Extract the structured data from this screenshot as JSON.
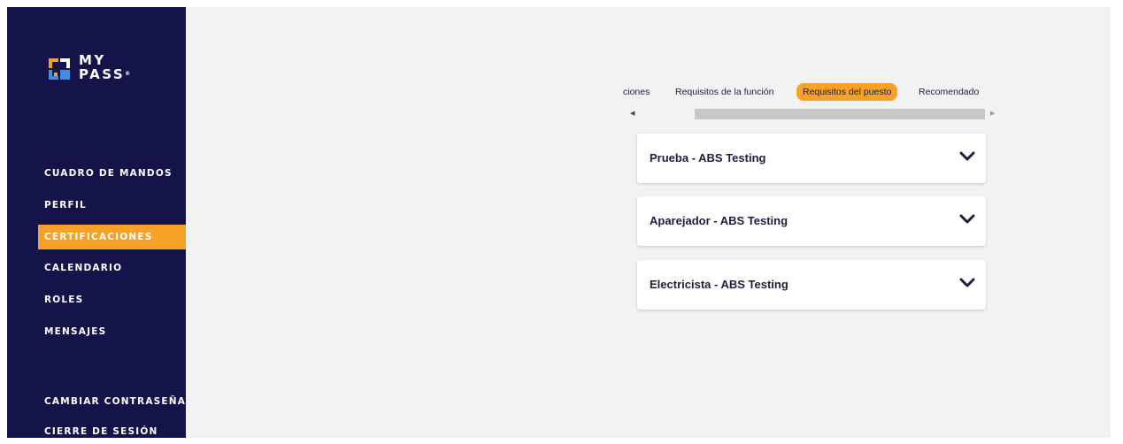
{
  "brand": {
    "line1": "MY",
    "line2": "PASS",
    "tm": "®"
  },
  "sidebar": {
    "items": [
      {
        "label": "CUADRO DE MANDOS",
        "active": false
      },
      {
        "label": "PERFIL",
        "active": false
      },
      {
        "label": "CERTIFICACIONES",
        "active": true
      },
      {
        "label": "CALENDARIO",
        "active": false
      },
      {
        "label": "ROLES",
        "active": false
      },
      {
        "label": "MENSAJES",
        "active": false
      },
      {
        "label": "CAMBIAR CONTRASEÑA",
        "active": false
      },
      {
        "label": "CIERRE DE SESIÓN",
        "active": false
      }
    ]
  },
  "tabs": [
    {
      "label": "ciones",
      "active": false
    },
    {
      "label": "Requisitos de la función",
      "active": false
    },
    {
      "label": "Requisitos del puesto",
      "active": true
    },
    {
      "label": "Recomendado",
      "active": false
    }
  ],
  "scroll": {
    "left_arrow": "◀",
    "right_arrow": "▶"
  },
  "cards": [
    {
      "title": "Prueba - ABS Testing"
    },
    {
      "title": "Aparejador - ABS Testing"
    },
    {
      "title": "Electricista - ABS Testing"
    }
  ],
  "colors": {
    "sidebar": "#14144a",
    "accent": "#f7a128",
    "text": "#1d1d3f",
    "logo_orange": "#f7a128",
    "logo_blue": "#3b8fe0"
  }
}
